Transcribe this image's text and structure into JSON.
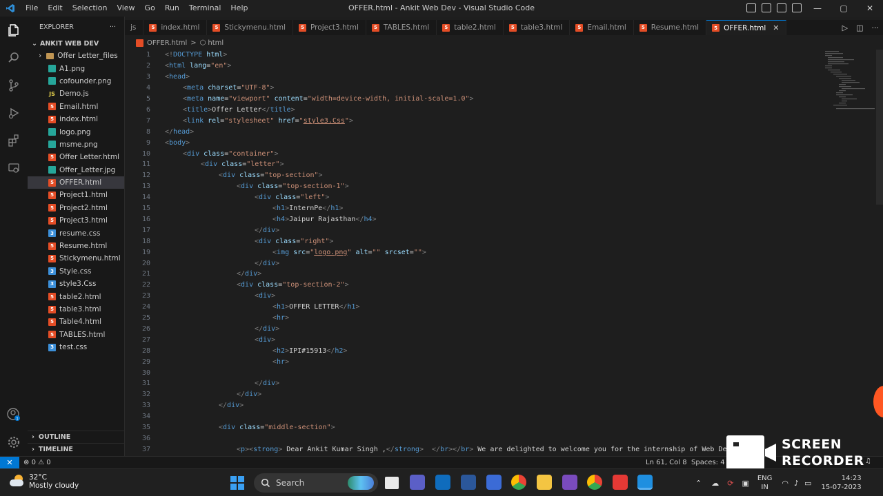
{
  "window": {
    "title": "OFFER.html - Ankit Web Dev - Visual Studio Code"
  },
  "menu": [
    "File",
    "Edit",
    "Selection",
    "View",
    "Go",
    "Run",
    "Terminal",
    "Help"
  ],
  "explorer": {
    "title": "EXPLORER",
    "root": "ANKIT WEB DEV",
    "files": [
      {
        "name": "Offer Letter_files",
        "type": "folder"
      },
      {
        "name": "A1.png",
        "type": "img"
      },
      {
        "name": "cofounder.png",
        "type": "img"
      },
      {
        "name": "Demo.js",
        "type": "js"
      },
      {
        "name": "Email.html",
        "type": "html"
      },
      {
        "name": "index.html",
        "type": "html"
      },
      {
        "name": "logo.png",
        "type": "img"
      },
      {
        "name": "msme.png",
        "type": "img"
      },
      {
        "name": "Offer Letter.html",
        "type": "html"
      },
      {
        "name": "Offer_Letter.jpg",
        "type": "img"
      },
      {
        "name": "OFFER.html",
        "type": "html",
        "active": true
      },
      {
        "name": "Project1.html",
        "type": "html"
      },
      {
        "name": "Project2.html",
        "type": "html"
      },
      {
        "name": "Project3.html",
        "type": "html"
      },
      {
        "name": "resume.css",
        "type": "css"
      },
      {
        "name": "Resume.html",
        "type": "html"
      },
      {
        "name": "Stickymenu.html",
        "type": "html"
      },
      {
        "name": "Style.css",
        "type": "css"
      },
      {
        "name": "style3.Css",
        "type": "css"
      },
      {
        "name": "table2.html",
        "type": "html"
      },
      {
        "name": "table3.html",
        "type": "html"
      },
      {
        "name": "Table4.html",
        "type": "html"
      },
      {
        "name": "TABLES.html",
        "type": "html"
      },
      {
        "name": "test.css",
        "type": "css"
      }
    ],
    "outline": "OUTLINE",
    "timeline": "TIMELINE"
  },
  "tabs": [
    {
      "name": "js",
      "type": "none"
    },
    {
      "name": "index.html",
      "type": "html"
    },
    {
      "name": "Stickymenu.html",
      "type": "html"
    },
    {
      "name": "Project3.html",
      "type": "html"
    },
    {
      "name": "TABLES.html",
      "type": "html"
    },
    {
      "name": "table2.html",
      "type": "html"
    },
    {
      "name": "table3.html",
      "type": "html"
    },
    {
      "name": "Email.html",
      "type": "html"
    },
    {
      "name": "Resume.html",
      "type": "html"
    },
    {
      "name": "OFFER.html",
      "type": "html",
      "active": true
    }
  ],
  "breadcrumb": {
    "file": "OFFER.html",
    "sep": ">",
    "node": "html"
  },
  "code": [
    {
      "n": "1",
      "i": 0,
      "tokens": [
        [
          "t",
          "<!"
        ],
        [
          "tn",
          "DOCTYPE"
        ],
        [
          "tx",
          " "
        ],
        [
          "an",
          "html"
        ],
        [
          "t",
          ">"
        ]
      ]
    },
    {
      "n": "2",
      "i": 0,
      "tokens": [
        [
          "t",
          "<"
        ],
        [
          "tn",
          "html"
        ],
        [
          "tx",
          " "
        ],
        [
          "an",
          "lang"
        ],
        [
          "tx",
          "="
        ],
        [
          "av",
          "\"en\""
        ],
        [
          "t",
          ">"
        ]
      ]
    },
    {
      "n": "3",
      "i": 0,
      "tokens": [
        [
          "t",
          "<"
        ],
        [
          "tn",
          "head"
        ],
        [
          "t",
          ">"
        ]
      ]
    },
    {
      "n": "4",
      "i": 1,
      "tokens": [
        [
          "t",
          "<"
        ],
        [
          "tn",
          "meta"
        ],
        [
          "tx",
          " "
        ],
        [
          "an",
          "charset"
        ],
        [
          "tx",
          "="
        ],
        [
          "av",
          "\"UTF-8\""
        ],
        [
          "t",
          ">"
        ]
      ]
    },
    {
      "n": "5",
      "i": 1,
      "tokens": [
        [
          "t",
          "<"
        ],
        [
          "tn",
          "meta"
        ],
        [
          "tx",
          " "
        ],
        [
          "an",
          "name"
        ],
        [
          "tx",
          "="
        ],
        [
          "av",
          "\"viewport\""
        ],
        [
          "tx",
          " "
        ],
        [
          "an",
          "content"
        ],
        [
          "tx",
          "="
        ],
        [
          "av",
          "\"width=device-width, initial-scale=1.0\""
        ],
        [
          "t",
          ">"
        ]
      ]
    },
    {
      "n": "6",
      "i": 1,
      "tokens": [
        [
          "t",
          "<"
        ],
        [
          "tn",
          "title"
        ],
        [
          "t",
          ">"
        ],
        [
          "tx",
          "Offer Letter"
        ],
        [
          "t",
          "</"
        ],
        [
          "tn",
          "title"
        ],
        [
          "t",
          ">"
        ]
      ]
    },
    {
      "n": "7",
      "i": 1,
      "tokens": [
        [
          "t",
          "<"
        ],
        [
          "tn",
          "link"
        ],
        [
          "tx",
          " "
        ],
        [
          "an",
          "rel"
        ],
        [
          "tx",
          "="
        ],
        [
          "av",
          "\"stylesheet\""
        ],
        [
          "tx",
          " "
        ],
        [
          "an",
          "href"
        ],
        [
          "tx",
          "="
        ],
        [
          "av",
          "\""
        ],
        [
          "av",
          "style3.Css",
          "ul"
        ],
        [
          "av",
          "\""
        ],
        [
          "t",
          ">"
        ]
      ]
    },
    {
      "n": "8",
      "i": 0,
      "tokens": [
        [
          "t",
          "</"
        ],
        [
          "tn",
          "head"
        ],
        [
          "t",
          ">"
        ]
      ]
    },
    {
      "n": "9",
      "i": 0,
      "tokens": [
        [
          "t",
          "<"
        ],
        [
          "tn",
          "body"
        ],
        [
          "t",
          ">"
        ]
      ]
    },
    {
      "n": "10",
      "i": 1,
      "tokens": [
        [
          "t",
          "<"
        ],
        [
          "tn",
          "div"
        ],
        [
          "tx",
          " "
        ],
        [
          "an",
          "class"
        ],
        [
          "tx",
          "="
        ],
        [
          "av",
          "\"container\""
        ],
        [
          "t",
          ">"
        ]
      ]
    },
    {
      "n": "11",
      "i": 2,
      "tokens": [
        [
          "t",
          "<"
        ],
        [
          "tn",
          "div"
        ],
        [
          "tx",
          " "
        ],
        [
          "an",
          "class"
        ],
        [
          "tx",
          "="
        ],
        [
          "av",
          "\"letter\""
        ],
        [
          "t",
          ">"
        ]
      ]
    },
    {
      "n": "12",
      "i": 3,
      "tokens": [
        [
          "t",
          "<"
        ],
        [
          "tn",
          "div"
        ],
        [
          "tx",
          " "
        ],
        [
          "an",
          "class"
        ],
        [
          "tx",
          "="
        ],
        [
          "av",
          "\"top-section\""
        ],
        [
          "t",
          ">"
        ]
      ]
    },
    {
      "n": "13",
      "i": 4,
      "tokens": [
        [
          "t",
          "<"
        ],
        [
          "tn",
          "div"
        ],
        [
          "tx",
          " "
        ],
        [
          "an",
          "class"
        ],
        [
          "tx",
          "="
        ],
        [
          "av",
          "\"top-section-1\""
        ],
        [
          "t",
          ">"
        ]
      ]
    },
    {
      "n": "14",
      "i": 5,
      "tokens": [
        [
          "t",
          "<"
        ],
        [
          "tn",
          "div"
        ],
        [
          "tx",
          " "
        ],
        [
          "an",
          "class"
        ],
        [
          "tx",
          "="
        ],
        [
          "av",
          "\"left\""
        ],
        [
          "t",
          ">"
        ]
      ]
    },
    {
      "n": "15",
      "i": 6,
      "tokens": [
        [
          "t",
          "<"
        ],
        [
          "tn",
          "h1"
        ],
        [
          "t",
          ">"
        ],
        [
          "tx",
          "InternPe"
        ],
        [
          "t",
          "</"
        ],
        [
          "tn",
          "h1"
        ],
        [
          "t",
          ">"
        ]
      ]
    },
    {
      "n": "16",
      "i": 6,
      "tokens": [
        [
          "t",
          "<"
        ],
        [
          "tn",
          "h4"
        ],
        [
          "t",
          ">"
        ],
        [
          "tx",
          "Jaipur Rajasthan"
        ],
        [
          "t",
          "</"
        ],
        [
          "tn",
          "h4"
        ],
        [
          "t",
          ">"
        ]
      ]
    },
    {
      "n": "17",
      "i": 5,
      "tokens": [
        [
          "t",
          "</"
        ],
        [
          "tn",
          "div"
        ],
        [
          "t",
          ">"
        ]
      ]
    },
    {
      "n": "18",
      "i": 5,
      "tokens": [
        [
          "t",
          "<"
        ],
        [
          "tn",
          "div"
        ],
        [
          "tx",
          " "
        ],
        [
          "an",
          "class"
        ],
        [
          "tx",
          "="
        ],
        [
          "av",
          "\"right\""
        ],
        [
          "t",
          ">"
        ]
      ]
    },
    {
      "n": "19",
      "i": 6,
      "tokens": [
        [
          "t",
          "<"
        ],
        [
          "tn",
          "img"
        ],
        [
          "tx",
          " "
        ],
        [
          "an",
          "src"
        ],
        [
          "tx",
          "="
        ],
        [
          "av",
          "\""
        ],
        [
          "av",
          "logo.png",
          "ul"
        ],
        [
          "av",
          "\""
        ],
        [
          "tx",
          " "
        ],
        [
          "an",
          "alt"
        ],
        [
          "tx",
          "="
        ],
        [
          "av",
          "\"\""
        ],
        [
          "tx",
          " "
        ],
        [
          "an",
          "srcset"
        ],
        [
          "tx",
          "="
        ],
        [
          "av",
          "\"\""
        ],
        [
          "t",
          ">"
        ]
      ]
    },
    {
      "n": "20",
      "i": 5,
      "tokens": [
        [
          "t",
          "</"
        ],
        [
          "tn",
          "div"
        ],
        [
          "t",
          ">"
        ]
      ]
    },
    {
      "n": "21",
      "i": 4,
      "tokens": [
        [
          "t",
          "</"
        ],
        [
          "tn",
          "div"
        ],
        [
          "t",
          ">"
        ]
      ]
    },
    {
      "n": "22",
      "i": 4,
      "tokens": [
        [
          "t",
          "<"
        ],
        [
          "tn",
          "div"
        ],
        [
          "tx",
          " "
        ],
        [
          "an",
          "class"
        ],
        [
          "tx",
          "="
        ],
        [
          "av",
          "\"top-section-2\""
        ],
        [
          "t",
          ">"
        ]
      ]
    },
    {
      "n": "23",
      "i": 5,
      "tokens": [
        [
          "t",
          "<"
        ],
        [
          "tn",
          "div"
        ],
        [
          "t",
          ">"
        ]
      ]
    },
    {
      "n": "24",
      "i": 6,
      "tokens": [
        [
          "t",
          "<"
        ],
        [
          "tn",
          "h1"
        ],
        [
          "t",
          ">"
        ],
        [
          "tx",
          "OFFER LETTER"
        ],
        [
          "t",
          "</"
        ],
        [
          "tn",
          "h1"
        ],
        [
          "t",
          ">"
        ]
      ]
    },
    {
      "n": "25",
      "i": 6,
      "tokens": [
        [
          "t",
          "<"
        ],
        [
          "tn",
          "hr"
        ],
        [
          "t",
          ">"
        ]
      ]
    },
    {
      "n": "26",
      "i": 5,
      "tokens": [
        [
          "t",
          "</"
        ],
        [
          "tn",
          "div"
        ],
        [
          "t",
          ">"
        ]
      ]
    },
    {
      "n": "27",
      "i": 5,
      "tokens": [
        [
          "t",
          "<"
        ],
        [
          "tn",
          "div"
        ],
        [
          "t",
          ">"
        ]
      ]
    },
    {
      "n": "28",
      "i": 6,
      "tokens": [
        [
          "t",
          "<"
        ],
        [
          "tn",
          "h2"
        ],
        [
          "t",
          ">"
        ],
        [
          "tx",
          "IPI#15913"
        ],
        [
          "t",
          "</"
        ],
        [
          "tn",
          "h2"
        ],
        [
          "t",
          ">"
        ]
      ]
    },
    {
      "n": "29",
      "i": 6,
      "tokens": [
        [
          "t",
          "<"
        ],
        [
          "tn",
          "hr"
        ],
        [
          "t",
          ">"
        ]
      ]
    },
    {
      "n": "30",
      "i": 0,
      "tokens": []
    },
    {
      "n": "31",
      "i": 5,
      "tokens": [
        [
          "t",
          "</"
        ],
        [
          "tn",
          "div"
        ],
        [
          "t",
          ">"
        ]
      ]
    },
    {
      "n": "32",
      "i": 4,
      "tokens": [
        [
          "t",
          "</"
        ],
        [
          "tn",
          "div"
        ],
        [
          "t",
          ">"
        ]
      ]
    },
    {
      "n": "33",
      "i": 3,
      "tokens": [
        [
          "t",
          "</"
        ],
        [
          "tn",
          "div"
        ],
        [
          "t",
          ">"
        ]
      ]
    },
    {
      "n": "34",
      "i": 0,
      "tokens": []
    },
    {
      "n": "35",
      "i": 3,
      "tokens": [
        [
          "t",
          "<"
        ],
        [
          "tn",
          "div"
        ],
        [
          "tx",
          " "
        ],
        [
          "an",
          "class"
        ],
        [
          "tx",
          "="
        ],
        [
          "av",
          "\"middle-section\""
        ],
        [
          "t",
          ">"
        ]
      ]
    },
    {
      "n": "36",
      "i": 0,
      "tokens": []
    },
    {
      "n": "37",
      "i": 4,
      "tokens": [
        [
          "t",
          "<"
        ],
        [
          "tn",
          "p"
        ],
        [
          "t",
          "><"
        ],
        [
          "tn",
          "strong"
        ],
        [
          "t",
          ">"
        ],
        [
          "tx",
          " Dear Ankit Kumar Singh ,"
        ],
        [
          "t",
          "</"
        ],
        [
          "tn",
          "strong"
        ],
        [
          "t",
          ">"
        ],
        [
          "tx",
          "  "
        ],
        [
          "t",
          "</"
        ],
        [
          "tn",
          "br"
        ],
        [
          "t",
          "></"
        ],
        [
          "tn",
          "br"
        ],
        [
          "t",
          ">"
        ],
        [
          "tx",
          " We are delighted to welcome you for the internship of Web Development"
        ]
      ]
    }
  ],
  "status": {
    "errors": "0",
    "warnings": "0",
    "position": "Ln 61, Col 8",
    "spaces": "Spaces: 4"
  },
  "recorder": {
    "line1": "SCREEN",
    "line2": "RECORDER"
  },
  "taskbar": {
    "temp": "32°C",
    "weather": "Mostly cloudy",
    "search": "Search",
    "lang1": "ENG",
    "lang2": "IN",
    "time": "14:23",
    "date": "15-07-2023"
  },
  "colors": {
    "accent": "#0078d4",
    "html_icon": "#e44d26",
    "css_icon": "#3c8fd8",
    "img_icon": "#26a69a"
  }
}
